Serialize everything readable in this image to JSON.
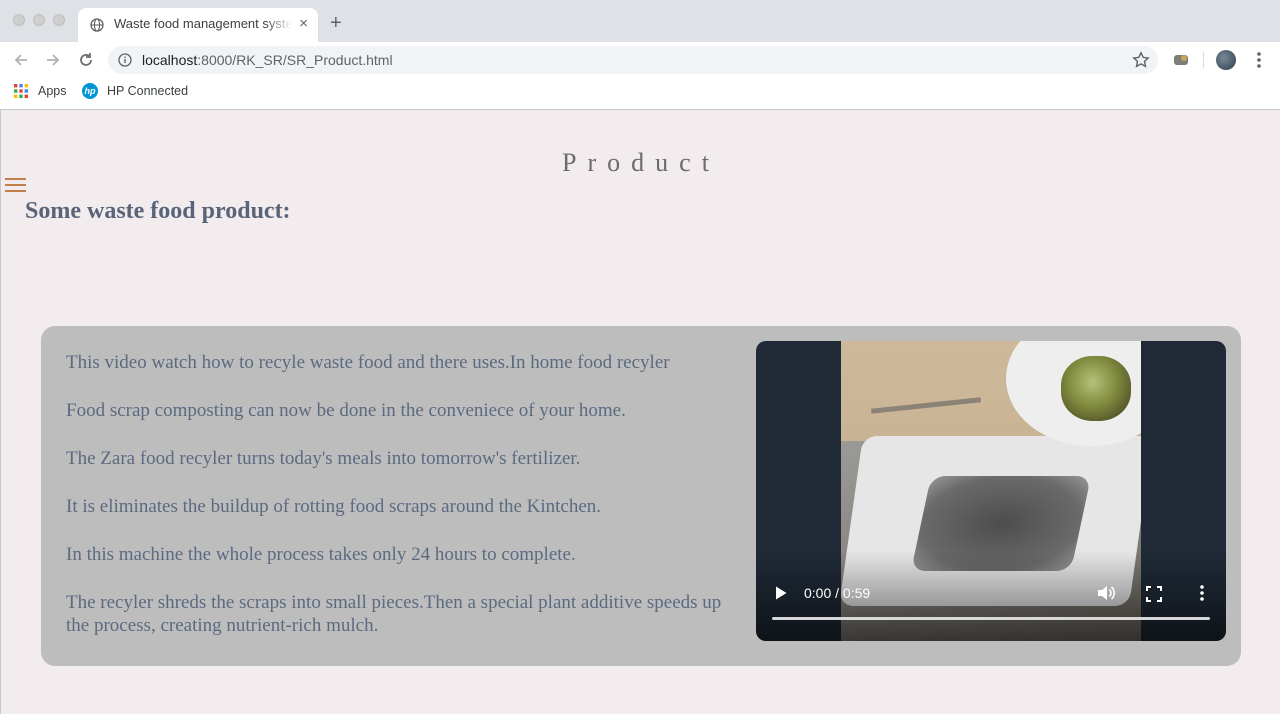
{
  "browser": {
    "tab_title": "Waste food management system",
    "tab_close": "×",
    "new_tab": "+",
    "url_host": "localhost",
    "url_rest": ":8000/RK_SR/SR_Product.html",
    "bookmarks": [
      {
        "label": "Apps",
        "icon": "apps-grid-icon"
      },
      {
        "label": "HP Connected",
        "icon": "hp-logo-icon"
      }
    ]
  },
  "page": {
    "title": "Product",
    "subheading": "Some waste food product:",
    "paragraphs": [
      "This video watch how to recyle waste food and there uses.In home food recyler",
      "Food scrap composting can now be done in the conveniece of your home.",
      "The Zara food recyler turns today's meals into tomorrow's fertilizer.",
      "It is eliminates the buildup of rotting food scraps around the Kintchen.",
      "In this machine the whole process takes only 24 hours to complete.",
      "The recyler shreds the scraps into small pieces.Then a special plant additive speeds up the process, creating nutrient-rich mulch."
    ],
    "video": {
      "time": "0:00 / 0:59",
      "progress": 0
    }
  },
  "colors": {
    "hamburger": "#c2814a",
    "card_bg": "#bdbdbd",
    "text": "#5c6a80"
  }
}
